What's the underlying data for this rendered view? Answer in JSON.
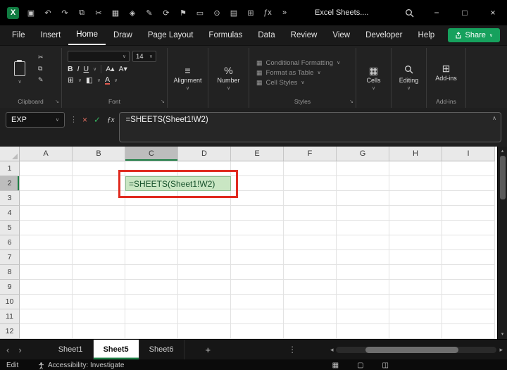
{
  "titlebar": {
    "logo_letter": "X",
    "title": "Excel Sheets....",
    "quick_icons": [
      {
        "name": "save-icon",
        "glyph": "▣"
      },
      {
        "name": "undo-icon",
        "glyph": "↶"
      },
      {
        "name": "redo-icon",
        "glyph": "↷"
      },
      {
        "name": "copy-icon",
        "glyph": "⧉"
      },
      {
        "name": "cut-icon",
        "glyph": "✂"
      },
      {
        "name": "picture-icon",
        "glyph": "▦"
      },
      {
        "name": "shapes-icon",
        "glyph": "◈"
      },
      {
        "name": "format-painter-icon",
        "glyph": "✎"
      },
      {
        "name": "refresh-icon",
        "glyph": "⟳"
      },
      {
        "name": "flag-icon",
        "glyph": "⚑"
      },
      {
        "name": "frame-icon",
        "glyph": "▭"
      },
      {
        "name": "camera-icon",
        "glyph": "⊙"
      },
      {
        "name": "workbook-icon",
        "glyph": "▤"
      },
      {
        "name": "table-icon",
        "glyph": "⊞"
      },
      {
        "name": "function-icon",
        "glyph": "ƒx"
      },
      {
        "name": "more-commands-icon",
        "glyph": "»"
      }
    ],
    "window_controls": {
      "minimize": "−",
      "maximize": "□",
      "close": "×"
    }
  },
  "menubar": {
    "items": [
      "File",
      "Insert",
      "Home",
      "Draw",
      "Page Layout",
      "Formulas",
      "Data",
      "Review",
      "View",
      "Developer",
      "Help"
    ],
    "active": "Home",
    "share_label": "Share"
  },
  "ribbon": {
    "clipboard": {
      "label": "Clipboard"
    },
    "font": {
      "label": "Font",
      "size": "14",
      "bold": "B",
      "italic": "I",
      "underline": "U",
      "color_letter": "A"
    },
    "alignment": {
      "label": "Alignment"
    },
    "number": {
      "label": "Number",
      "symbol": "%"
    },
    "styles": {
      "label": "Styles",
      "items": [
        "Conditional Formatting",
        "Format as Table",
        "Cell Styles"
      ]
    },
    "cells": {
      "label": "Cells"
    },
    "editing": {
      "label": "Editing"
    },
    "addins": {
      "label": "Add-ins"
    }
  },
  "formula_bar": {
    "name_box": "EXP",
    "formula": "=SHEETS(Sheet1!W2)"
  },
  "grid": {
    "columns": [
      "A",
      "B",
      "C",
      "D",
      "E",
      "F",
      "G",
      "H",
      "I"
    ],
    "rows": [
      "1",
      "2",
      "3",
      "4",
      "5",
      "6",
      "7",
      "8",
      "9",
      "10",
      "11",
      "12"
    ],
    "selected_column": "C",
    "selected_row": "2",
    "edit_cell": {
      "ref": "C2",
      "text": "=SHEETS(Sheet1!W2)"
    }
  },
  "sheet_tabs": {
    "tabs": [
      "Sheet1",
      "Sheet5",
      "Sheet6"
    ],
    "active": "Sheet5",
    "add_label": "+"
  },
  "status_bar": {
    "mode": "Edit",
    "accessibility_label": "Accessibility: Investigate"
  },
  "colors": {
    "excel_green": "#107C41",
    "share_green": "#16a15d",
    "annotation_red": "#e02b20",
    "edit_cell_bg": "#c9e6c3",
    "edit_cell_text": "#17512b"
  }
}
